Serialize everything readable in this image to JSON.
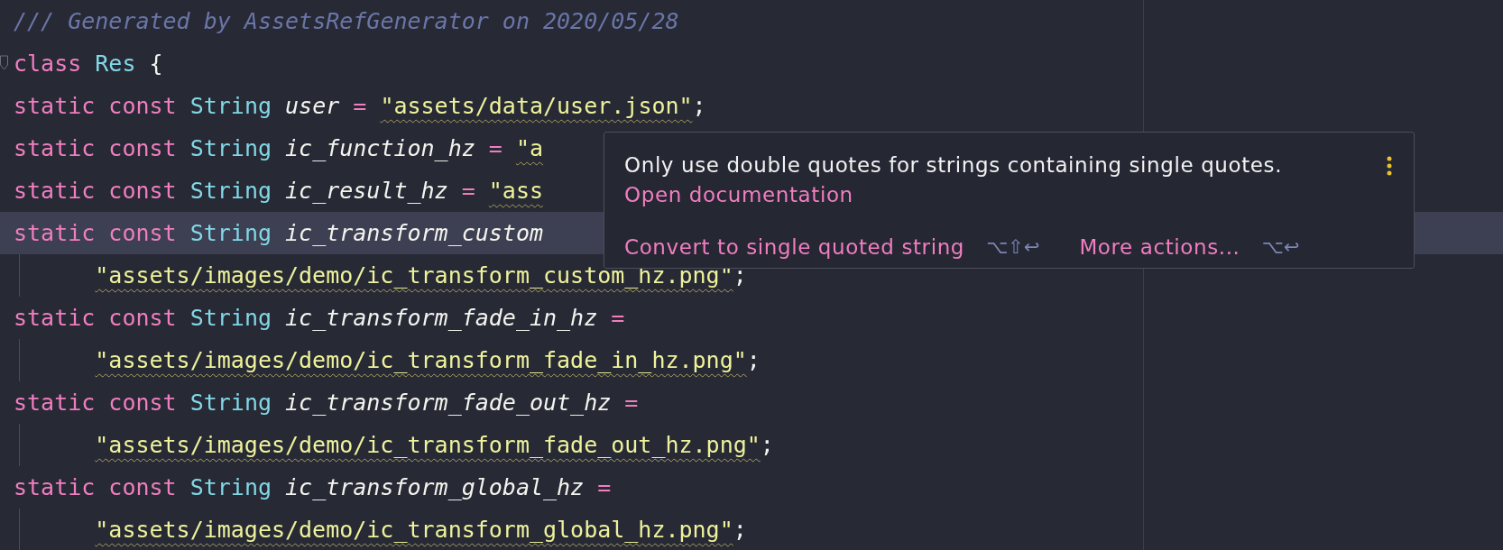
{
  "editor": {
    "lines": [
      {
        "kind": "comment",
        "current": false,
        "tokens": [
          {
            "kind": "comment",
            "text": "/// Generated by AssetsRefGenerator on 2020/05/28"
          }
        ]
      },
      {
        "kind": "class_open",
        "current": false,
        "tokens": [
          {
            "kind": "keyword",
            "text": "class "
          },
          {
            "kind": "type",
            "text": "Res "
          },
          {
            "kind": "punct",
            "text": "{"
          }
        ]
      },
      {
        "kind": "declaration",
        "current": false,
        "tokens": [
          {
            "kind": "keyword",
            "text": "static const "
          },
          {
            "kind": "type",
            "text": "String "
          },
          {
            "kind": "name",
            "text": "user "
          },
          {
            "kind": "op",
            "text": "= "
          },
          {
            "kind": "string",
            "text": "\"assets/data/user.json\"",
            "warning": true
          },
          {
            "kind": "punct",
            "text": ";"
          }
        ]
      },
      {
        "kind": "declaration",
        "current": false,
        "tokens": [
          {
            "kind": "keyword",
            "text": "static const "
          },
          {
            "kind": "type",
            "text": "String "
          },
          {
            "kind": "name",
            "text": "ic_function_hz "
          },
          {
            "kind": "op",
            "text": "= "
          },
          {
            "kind": "string",
            "text": "\"a",
            "warning": true
          }
        ]
      },
      {
        "kind": "declaration",
        "current": false,
        "tokens": [
          {
            "kind": "keyword",
            "text": "static const "
          },
          {
            "kind": "type",
            "text": "String "
          },
          {
            "kind": "name",
            "text": "ic_result_hz "
          },
          {
            "kind": "op",
            "text": "= "
          },
          {
            "kind": "string",
            "text": "\"ass",
            "warning": true
          }
        ]
      },
      {
        "kind": "declaration",
        "current": true,
        "tokens": [
          {
            "kind": "keyword",
            "text": "static const "
          },
          {
            "kind": "type",
            "text": "String "
          },
          {
            "kind": "name",
            "text": "ic_transform_custom"
          }
        ]
      },
      {
        "kind": "continuation",
        "current": false,
        "tokens": [
          {
            "kind": "string",
            "text": "\"assets/images/demo/ic_transform_custom_hz.png\"",
            "warning": true
          },
          {
            "kind": "punct",
            "text": ";"
          }
        ]
      },
      {
        "kind": "declaration",
        "current": false,
        "tokens": [
          {
            "kind": "keyword",
            "text": "static const "
          },
          {
            "kind": "type",
            "text": "String "
          },
          {
            "kind": "name",
            "text": "ic_transform_fade_in_hz "
          },
          {
            "kind": "op",
            "text": "="
          }
        ]
      },
      {
        "kind": "continuation",
        "current": false,
        "tokens": [
          {
            "kind": "string",
            "text": "\"assets/images/demo/ic_transform_fade_in_hz.png\"",
            "warning": true
          },
          {
            "kind": "punct",
            "text": ";"
          }
        ]
      },
      {
        "kind": "declaration",
        "current": false,
        "tokens": [
          {
            "kind": "keyword",
            "text": "static const "
          },
          {
            "kind": "type",
            "text": "String "
          },
          {
            "kind": "name",
            "text": "ic_transform_fade_out_hz "
          },
          {
            "kind": "op",
            "text": "="
          }
        ]
      },
      {
        "kind": "continuation",
        "current": false,
        "tokens": [
          {
            "kind": "string",
            "text": "\"assets/images/demo/ic_transform_fade_out_hz.png\"",
            "warning": true
          },
          {
            "kind": "punct",
            "text": ";"
          }
        ]
      },
      {
        "kind": "declaration",
        "current": false,
        "tokens": [
          {
            "kind": "keyword",
            "text": "static const "
          },
          {
            "kind": "type",
            "text": "String "
          },
          {
            "kind": "name",
            "text": "ic_transform_global_hz "
          },
          {
            "kind": "op",
            "text": "="
          }
        ]
      },
      {
        "kind": "continuation",
        "current": false,
        "tokens": [
          {
            "kind": "string",
            "text": "\"assets/images/demo/ic_transform_global_hz.png\"",
            "warning": true
          },
          {
            "kind": "punct",
            "text": ";"
          }
        ]
      }
    ]
  },
  "popup": {
    "message": "Only use double quotes for strings containing single quotes.",
    "link": "Open documentation",
    "actions": [
      {
        "label": "Convert to single quoted string",
        "shortcut": "⌥⇧↩"
      },
      {
        "label": "More actions...",
        "shortcut": "⌥↩"
      }
    ]
  }
}
